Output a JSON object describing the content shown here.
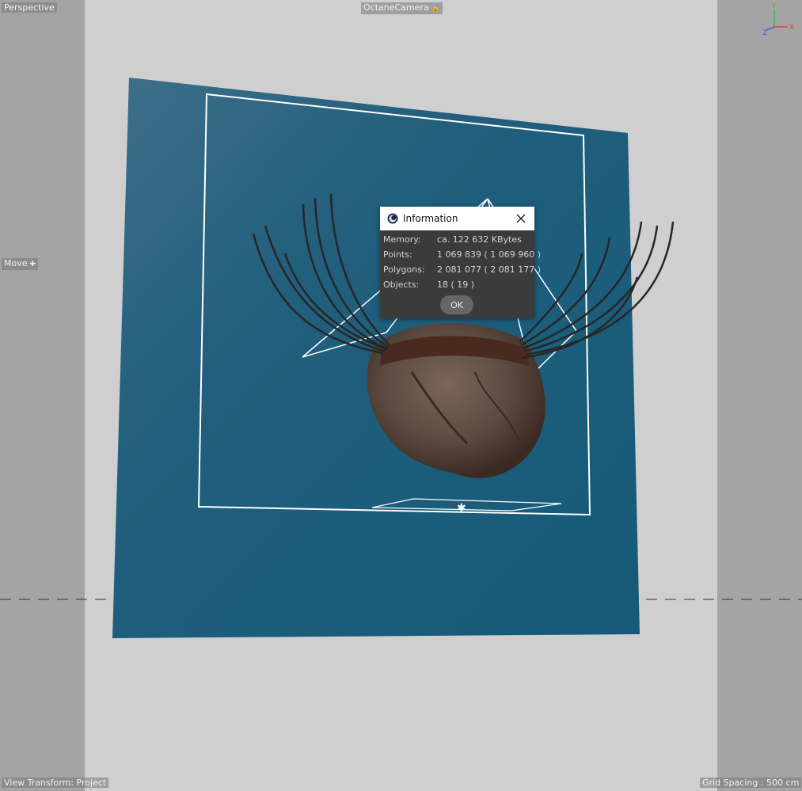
{
  "viewport": {
    "view_label": "Perspective",
    "camera_label": "OctaneCamera",
    "tool_label": "Move",
    "view_transform": "View Transform: Project",
    "grid_spacing": "Grid Spacing : 500 cm",
    "axes": {
      "y": "Y",
      "z": "Z",
      "x": "X"
    }
  },
  "dialog": {
    "title": "Information",
    "rows": [
      {
        "label": "Memory:",
        "value": "ca. 122 632 KBytes"
      },
      {
        "label": "Points:",
        "value": "1 069 839 ( 1 069 960 )"
      },
      {
        "label": "Polygons:",
        "value": "2 081 077 ( 2 081 177 )"
      },
      {
        "label": "Objects:",
        "value": "18 ( 19 )"
      }
    ],
    "ok_label": "OK"
  },
  "colors": {
    "background_plane": "#1d5a75",
    "safe_frame": "#ffffff"
  }
}
